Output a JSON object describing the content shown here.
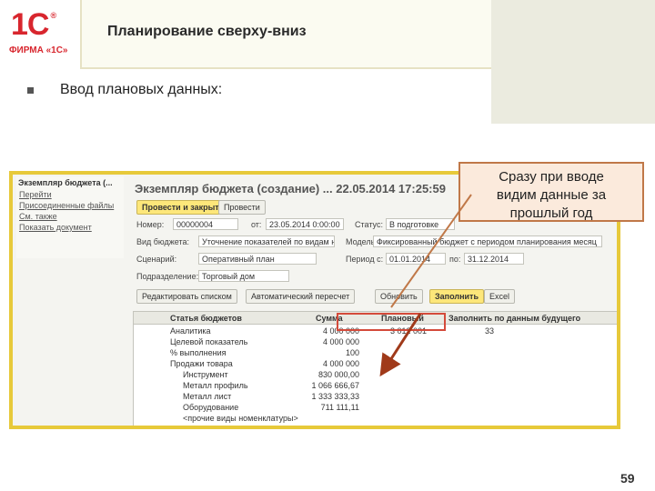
{
  "header": {
    "logo_mark": "1С",
    "logo_registered": "®",
    "logo_text": "ФИРМА «1С»",
    "title": "Планирование сверху-вниз"
  },
  "bullet": {
    "text": "Ввод плановых данных:"
  },
  "callout": {
    "lines": [
      "Сразу при вводе",
      "видим данные за",
      "прошлый год"
    ]
  },
  "app": {
    "nav_title": "Экземпляр бюджета (...",
    "nav_links": [
      "Перейти",
      "Присоединенные файлы",
      "См. также",
      "Показать документ"
    ],
    "doc_title": "Экземпляр бюджета (создание) ...",
    "doc_timestamp": "22.05.2014 17:25:59",
    "buttons": {
      "post_close": "Провести и закрыть",
      "post": "Провести",
      "edit_list": "Редактировать списком",
      "auto_recalc": "Автоматический пересчет",
      "refresh": "Обновить",
      "fill": "Заполнить",
      "excel": "Excel"
    },
    "fields": {
      "number_label": "Номер:",
      "number_value": "00000004",
      "date_label": "от:",
      "date_value": "23.05.2014 0:00:00",
      "status_label": "Статус:",
      "status_value": "В подготовке",
      "budget_view_label": "Вид бюджета:",
      "budget_view_value": "Уточнение показателей по видам ном",
      "model_label": "Модель:",
      "model_value": "Фиксированный бюджет с периодом планирования месяц",
      "scenario_label": "Сценарий:",
      "scenario_value": "Оперативный план",
      "period_label": "Период с:",
      "period_from": "01.01.2014",
      "period_to_label": "по:",
      "period_to": "31.12.2014",
      "division_label": "Подразделение:",
      "division_value": "Торговый дом"
    },
    "table": {
      "headers": [
        "Статья бюджетов",
        "Сумма",
        "Плановый",
        "Заполнить по данным будущего"
      ],
      "rows": [
        {
          "name": "Аналитика",
          "indent": 0,
          "v1": "4 000 000",
          "v2": "3 012 001",
          "v3": "33"
        },
        {
          "name": "Целевой показатель",
          "indent": 0,
          "v1": "4 000 000",
          "v2": "",
          "v3": ""
        },
        {
          "name": "% выполнения",
          "indent": 0,
          "v1": "100",
          "v2": "",
          "v3": ""
        },
        {
          "name": "Продажи товара",
          "indent": 0,
          "v1": "4 000 000",
          "v2": "",
          "v3": ""
        },
        {
          "name": "Инструмент",
          "indent": 1,
          "v1": "830 000,00",
          "v2": "",
          "v3": ""
        },
        {
          "name": "Металл профиль",
          "indent": 1,
          "v1": "1 066 666,67",
          "v2": "",
          "v3": ""
        },
        {
          "name": "Металл лист",
          "indent": 1,
          "v1": "1 333 333,33",
          "v2": "",
          "v3": ""
        },
        {
          "name": "Оборудование",
          "indent": 1,
          "v1": "711 111,11",
          "v2": "",
          "v3": ""
        },
        {
          "name": "<прочие виды номенклатуры>",
          "indent": 1,
          "v1": "",
          "v2": "",
          "v3": ""
        }
      ]
    }
  },
  "page_number": "59",
  "colors": {
    "brand": "#d8262e",
    "frame": "#e7c93a",
    "highlight": "#d44a3a",
    "callout_border": "#c07848"
  }
}
